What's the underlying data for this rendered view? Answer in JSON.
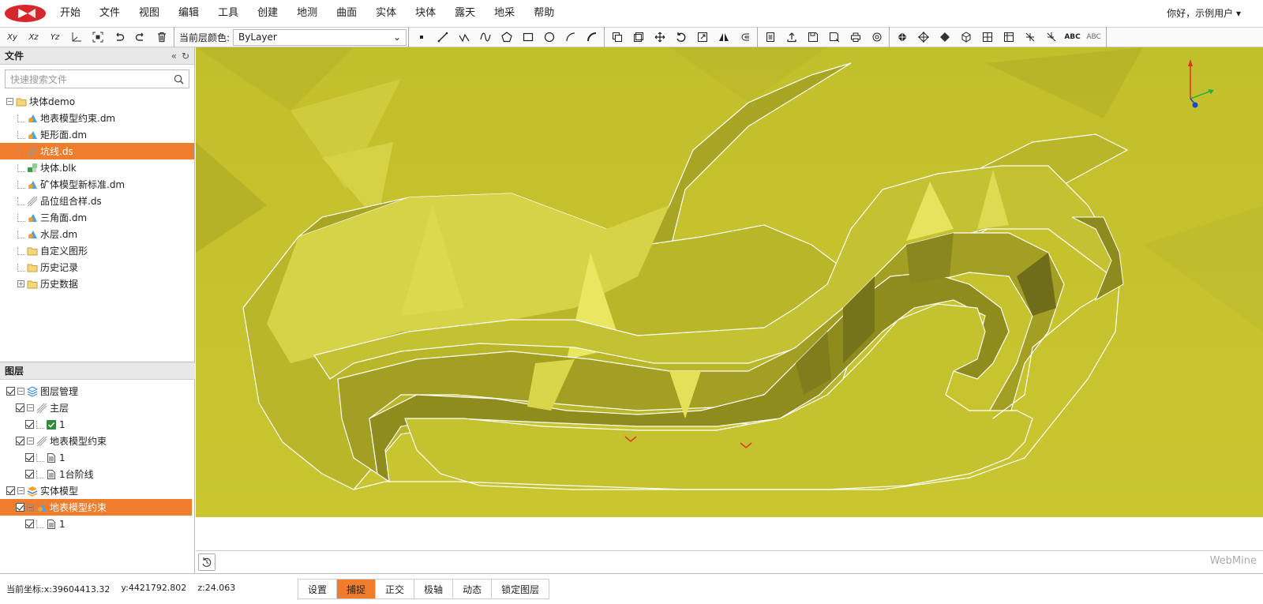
{
  "menu": [
    "开始",
    "文件",
    "视图",
    "编辑",
    "工具",
    "创建",
    "地测",
    "曲面",
    "实体",
    "块体",
    "露天",
    "地采",
    "帮助"
  ],
  "user_greeting": "你好，示例用户",
  "toolbar": {
    "layer_color_label": "当前层颜色:",
    "layer_color_value": "ByLayer",
    "coord_buttons": [
      "Xy",
      "Xz",
      "Yz"
    ],
    "abc_buttons": [
      "ABC",
      "ABC"
    ]
  },
  "file_panel": {
    "title": "文件",
    "search_placeholder": "快速搜索文件",
    "tree": [
      {
        "label": "块体demo",
        "icon": "folder-icon",
        "level": 0,
        "expander": "⊟"
      },
      {
        "label": "地表模型约束.dm",
        "icon": "surface-model-icon",
        "level": 1
      },
      {
        "label": "矩形面.dm",
        "icon": "surface-model-icon",
        "level": 1
      },
      {
        "label": "坑线.ds",
        "icon": "line-string-icon",
        "level": 1,
        "selected": true
      },
      {
        "label": "块体.blk",
        "icon": "block-model-icon",
        "level": 1
      },
      {
        "label": "矿体模型新标准.dm",
        "icon": "surface-model-icon",
        "level": 1
      },
      {
        "label": "品位组合样.ds",
        "icon": "line-string-icon",
        "level": 1
      },
      {
        "label": "三角面.dm",
        "icon": "surface-model-icon",
        "level": 1
      },
      {
        "label": "水层.dm",
        "icon": "surface-model-icon",
        "level": 1
      },
      {
        "label": "自定义图形",
        "icon": "folder-icon",
        "level": 1
      },
      {
        "label": "历史记录",
        "icon": "folder-icon",
        "level": 1
      },
      {
        "label": "历史数据",
        "icon": "folder-icon",
        "level": 1,
        "expander": "⊞"
      }
    ]
  },
  "layer_panel": {
    "title": "图层",
    "tree": [
      {
        "label": "图层管理",
        "icon": "layers-icon",
        "level": 0,
        "expander": "⊟"
      },
      {
        "label": "主层",
        "icon": "line-string-icon",
        "level": 1,
        "expander": "⊟"
      },
      {
        "label": "1",
        "icon": "green-check-icon",
        "level": 2
      },
      {
        "label": "地表模型约束",
        "icon": "line-string-icon",
        "level": 1,
        "expander": "⊟"
      },
      {
        "label": "1",
        "icon": "document-icon",
        "level": 2
      },
      {
        "label": "1台阶线",
        "icon": "document-icon",
        "level": 2
      },
      {
        "label": "实体模型",
        "icon": "layers-solid-icon",
        "level": 0,
        "expander": "⊟"
      },
      {
        "label": "地表模型约束",
        "icon": "surface-model-icon",
        "level": 1,
        "expander": "⊟",
        "selected": true
      },
      {
        "label": "1",
        "icon": "document-icon",
        "level": 2
      }
    ]
  },
  "viewport": {
    "background_color": "#c7c42e",
    "brand": "WebMine"
  },
  "status": {
    "x_label": "当前坐标:x:39604413.32",
    "y_label": "y:4421792.802",
    "z_label": "z:24.063",
    "buttons": [
      {
        "label": "设置",
        "active": false
      },
      {
        "label": "捕捉",
        "active": true
      },
      {
        "label": "正交",
        "active": false
      },
      {
        "label": "极轴",
        "active": false
      },
      {
        "label": "动态",
        "active": false
      },
      {
        "label": "锁定图层",
        "active": false
      }
    ]
  },
  "colors": {
    "accent": "#ef7d2d",
    "terrain": "#c7c42e",
    "logo": "#d7262c"
  }
}
